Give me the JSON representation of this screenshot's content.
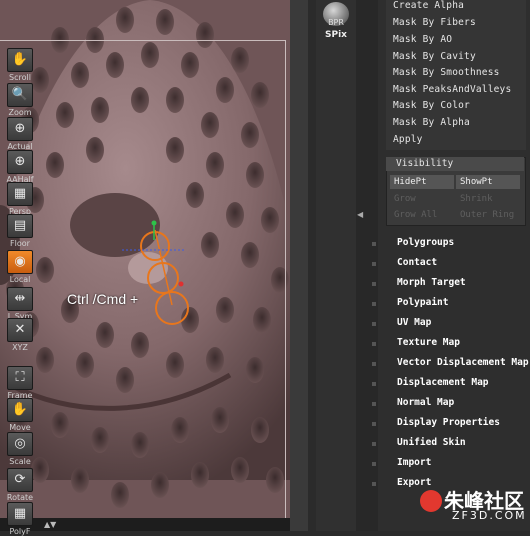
{
  "viewport": {
    "overlay_text": "Ctrl /Cmd +"
  },
  "shelf": {
    "bpr": "BPR",
    "spix": "SPix",
    "tools": [
      {
        "label": "Scroll",
        "icon": "hand-scroll-icon",
        "glyph": "✋"
      },
      {
        "label": "Zoom",
        "icon": "zoom-icon",
        "glyph": "🔍"
      },
      {
        "label": "Actual",
        "icon": "actual-size-icon",
        "glyph": "⊕"
      },
      {
        "label": "AAHalf",
        "icon": "aahalf-icon",
        "glyph": "⊕"
      },
      {
        "label": "Persp",
        "icon": "perspective-icon",
        "glyph": "▦"
      },
      {
        "label": "Floor",
        "icon": "floor-icon",
        "glyph": "▤"
      },
      {
        "label": "Local",
        "icon": "local-icon",
        "glyph": "◉"
      },
      {
        "label": "L.Sym",
        "icon": "local-symmetry-icon",
        "glyph": "⇹"
      },
      {
        "label": "XYZ",
        "icon": "xyz-icon",
        "glyph": "✕"
      },
      {
        "label": "Frame",
        "icon": "frame-icon",
        "glyph": "⛶"
      },
      {
        "label": "Move",
        "icon": "move-icon",
        "glyph": "✋"
      },
      {
        "label": "Scale",
        "icon": "scale-icon",
        "glyph": "◎"
      },
      {
        "label": "Rotate",
        "icon": "rotate-icon",
        "glyph": "⟳"
      },
      {
        "label": "PolyF",
        "icon": "polyframe-icon",
        "glyph": "▦"
      }
    ]
  },
  "masking": {
    "items": [
      "Create Alpha",
      "Mask By Fibers",
      "Mask By AO",
      "Mask By Cavity",
      "Mask By Smoothness",
      "Mask PeaksAndValleys",
      "Mask By Color",
      "Mask By Alpha",
      "Apply"
    ]
  },
  "visibility": {
    "title": "Visibility",
    "buttons": [
      {
        "label": "HidePt",
        "enabled": true
      },
      {
        "label": "ShowPt",
        "enabled": true
      },
      {
        "label": "Grow",
        "enabled": false
      },
      {
        "label": "Shrink",
        "enabled": false
      },
      {
        "label": "Grow All",
        "enabled": false
      },
      {
        "label": "Outer Ring",
        "enabled": false
      }
    ]
  },
  "subpalettes": [
    "Polygroups",
    "Contact",
    "Morph Target",
    "Polypaint",
    "UV Map",
    "Texture Map",
    "Vector Displacement Map",
    "Displacement Map",
    "Normal Map",
    "Display Properties",
    "Unified Skin",
    "Import",
    "Export"
  ],
  "watermark": {
    "chinese": "朱峰社区",
    "url": "ZF3D.COM"
  },
  "colors": {
    "accent": "#e8761c",
    "model": "#8a6e70",
    "panel": "#2e2e2e"
  }
}
